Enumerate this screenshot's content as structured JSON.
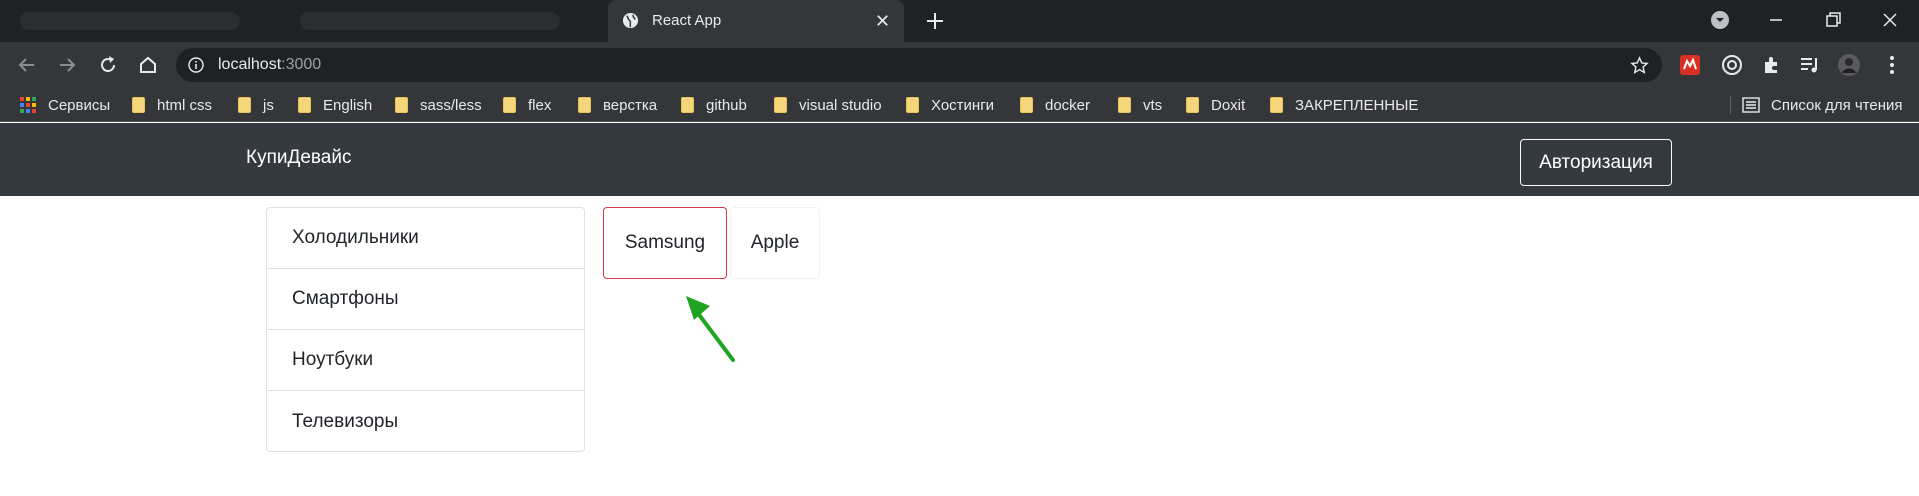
{
  "browser": {
    "tab": {
      "title": "React App"
    },
    "address": {
      "host": "localhost",
      "port": ":3000"
    },
    "bookmarks": [
      {
        "label": "Сервисы",
        "icon": "apps-icon"
      },
      {
        "label": "html css",
        "icon": "folder-icon"
      },
      {
        "label": "js",
        "icon": "folder-icon"
      },
      {
        "label": "English",
        "icon": "folder-icon"
      },
      {
        "label": "sass/less",
        "icon": "folder-icon"
      },
      {
        "label": "flex",
        "icon": "folder-icon"
      },
      {
        "label": "верстка",
        "icon": "folder-icon"
      },
      {
        "label": "github",
        "icon": "folder-icon"
      },
      {
        "label": "visual studio",
        "icon": "folder-icon"
      },
      {
        "label": "Хостинги",
        "icon": "folder-icon"
      },
      {
        "label": "docker",
        "icon": "folder-icon"
      },
      {
        "label": "vts",
        "icon": "folder-icon"
      },
      {
        "label": "Doxit",
        "icon": "folder-icon"
      },
      {
        "label": "ЗАКРЕПЛЕННЫЕ",
        "icon": "folder-icon"
      }
    ],
    "reading_list": "Список для чтения"
  },
  "navbar": {
    "brand": "КупиДевайс",
    "auth_button": "Авторизация"
  },
  "types": [
    {
      "label": "Холодильники"
    },
    {
      "label": "Смартфоны"
    },
    {
      "label": "Ноутбуки"
    },
    {
      "label": "Телевизоры"
    }
  ],
  "brands": [
    {
      "label": "Samsung",
      "selected": true
    },
    {
      "label": "Apple",
      "selected": false
    }
  ],
  "colors": {
    "navbar": "#343a40",
    "selected_border": "#dc3545",
    "annotation_arrow": "#1fa51f"
  }
}
